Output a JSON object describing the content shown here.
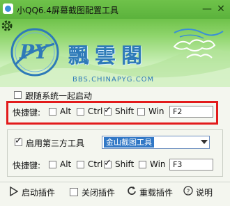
{
  "window": {
    "title": "小QQ6.4屏幕截图配置工具",
    "minimize_glyph": "—",
    "close_glyph": "✕"
  },
  "banner": {
    "logo_monogram": "PY",
    "logo_text": "飄雲閣",
    "url": "BBS.CHINAPYG.COM"
  },
  "options": {
    "follow_startup": {
      "label": "跟随系统一起启动",
      "checked": false
    }
  },
  "hotkey1": {
    "label": "快捷键:",
    "alt": {
      "label": "Alt",
      "checked": false
    },
    "ctrl": {
      "label": "Ctrl",
      "checked": false
    },
    "shift": {
      "label": "Shift",
      "checked": true
    },
    "win": {
      "label": "Win",
      "checked": false
    },
    "key": "F2"
  },
  "third_party": {
    "label": "启用第三方工具",
    "checked": true,
    "tool_selected": "金山截图工具"
  },
  "hotkey2": {
    "label": "快捷键:",
    "alt": {
      "label": "Alt",
      "checked": false
    },
    "ctrl": {
      "label": "Ctrl",
      "checked": false
    },
    "shift": {
      "label": "Shift",
      "checked": true
    },
    "win": {
      "label": "Win",
      "checked": false
    },
    "key": "F3"
  },
  "bottom_bar": {
    "start_plugin": "启动插件",
    "close_plugin": "关闭插件",
    "reload_plugin": "重载插件",
    "help": "说明"
  },
  "colors": {
    "title_green": "#6fc24a",
    "logo_blue": "#2e7ab8",
    "highlight_red": "#e21b1b",
    "select_blue": "#3178c6"
  }
}
